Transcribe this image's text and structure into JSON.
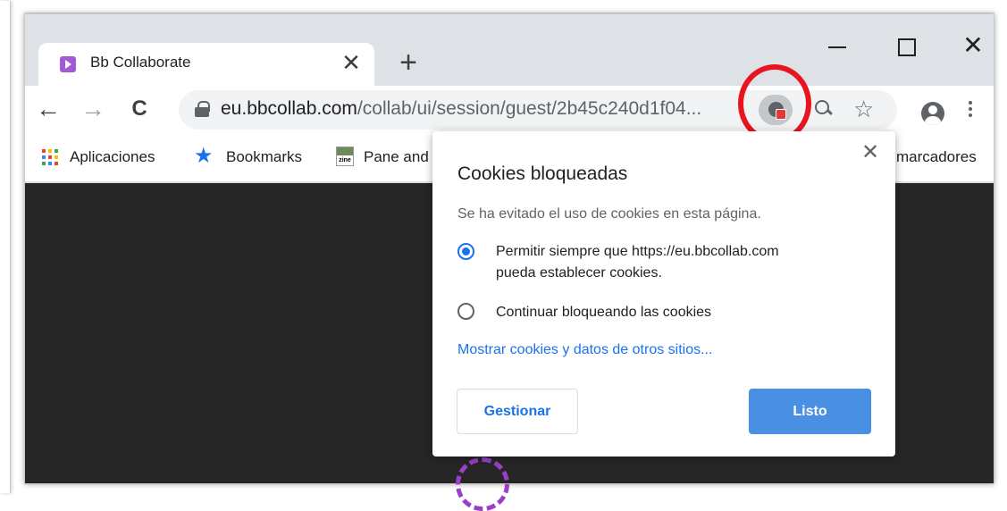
{
  "tab": {
    "title": "Bb Collaborate",
    "close": "✕",
    "new_tab": "+"
  },
  "window": {
    "close": "✕"
  },
  "toolbar": {
    "back": "←",
    "forward": "→",
    "reload": "C",
    "url_domain": "eu.bbcollab.com",
    "url_path": "/collab/ui/session/guest/2b45c240d1f04...",
    "star": "☆"
  },
  "bookmarks": {
    "apps": "Aplicaciones",
    "bookmarks": "Bookmarks",
    "star": "★",
    "zine_icon": "zine",
    "pane": "Pane and",
    "other": "marcadores",
    "apps_colors": [
      "#ea4335",
      "#fbbc04",
      "#34a853",
      "#4285f4",
      "#ea4335",
      "#fbbc04",
      "#34a853",
      "#4285f4",
      "#ea4335"
    ]
  },
  "dialog": {
    "close": "✕",
    "title": "Cookies bloqueadas",
    "description": "Se ha evitado el uso de cookies en esta página.",
    "option_allow_line1": "Permitir siempre que https://eu.bbcollab.com",
    "option_allow_line2": "pueda establecer cookies.",
    "option_block": "Continuar bloqueando las cookies",
    "link": "Mostrar cookies y datos de otros sitios...",
    "manage": "Gestionar",
    "done": "Listo",
    "selected_option": "allow"
  },
  "colors": {
    "accent": "#1a73e8",
    "done_button": "#4a90e2",
    "annotation": "#e8141f",
    "page_bg": "#262626",
    "spinner": "#9b3fc9"
  }
}
